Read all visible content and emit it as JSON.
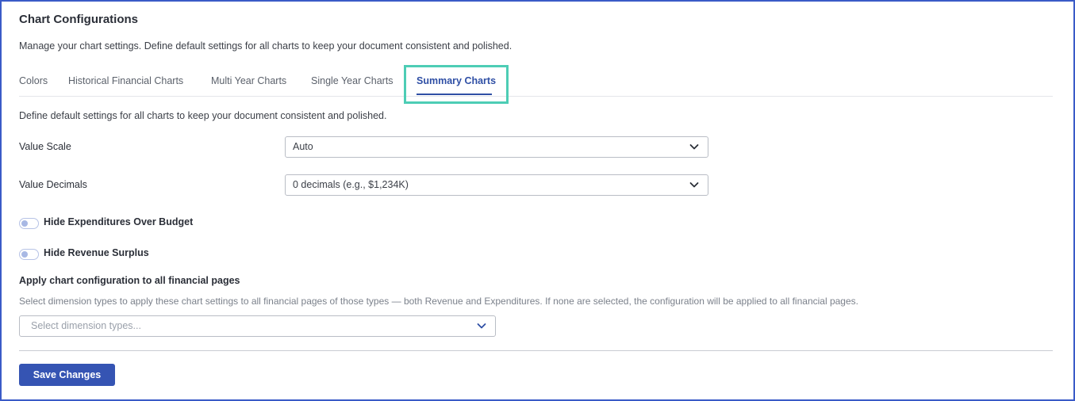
{
  "header": {
    "title": "Chart Configurations",
    "description": "Manage your chart settings. Define default settings for all charts to keep your document consistent and polished."
  },
  "tabs": [
    {
      "label": "Colors",
      "active": false
    },
    {
      "label": "Historical Financial Charts",
      "active": false
    },
    {
      "label": "Multi Year Charts",
      "active": false
    },
    {
      "label": "Single Year Charts",
      "active": false
    },
    {
      "label": "Summary Charts",
      "active": true
    }
  ],
  "summary": {
    "description": "Define default settings for all charts to keep your document consistent and polished.",
    "value_scale": {
      "label": "Value Scale",
      "value": "Auto"
    },
    "value_decimals": {
      "label": "Value Decimals",
      "value": "0 decimals (e.g., $1,234K)"
    },
    "toggles": [
      {
        "label": "Hide Expenditures Over Budget",
        "on": false
      },
      {
        "label": "Hide Revenue Surplus",
        "on": false
      }
    ],
    "apply": {
      "title": "Apply chart configuration to all financial pages",
      "description": "Select dimension types to apply these chart settings to all financial pages of those types — both Revenue and Expenditures. If none are selected, the configuration will be applied to all financial pages.",
      "placeholder": "Select dimension types..."
    }
  },
  "footer": {
    "save_label": "Save Changes"
  },
  "colors": {
    "accent": "#3554b3",
    "tab_highlight": "#4dcdb5",
    "frame_border": "#3a5bc7"
  },
  "icons": {
    "dropdown": "chevron-down-icon"
  }
}
